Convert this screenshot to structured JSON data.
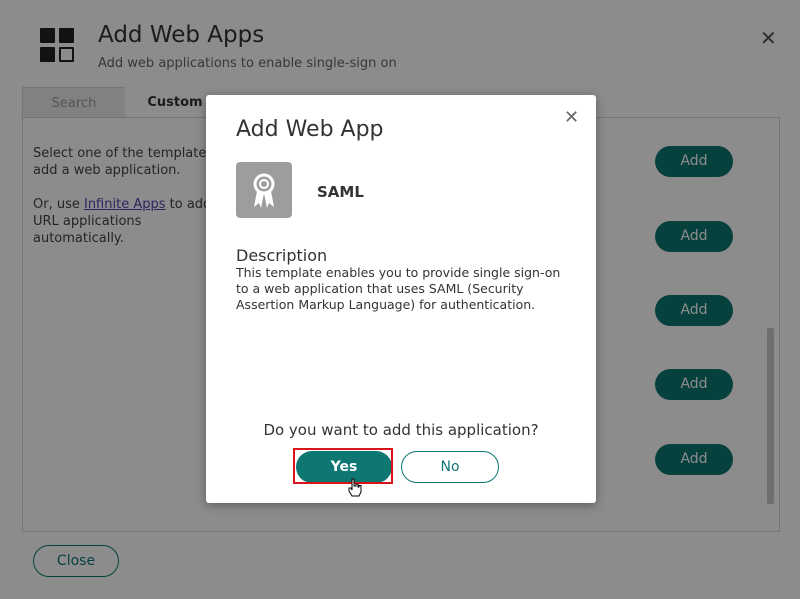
{
  "background": {
    "title": "Add Web Apps",
    "subtitle": "Add web applications to enable single-sign on",
    "tabs": [
      "Search",
      "Custom"
    ],
    "panel_text_1": "Select one of the templates to add a web application.",
    "panel_text_2_prefix": "Or, use ",
    "panel_text_2_link": "Infinite Apps",
    "panel_text_2_suffix": " to add URL applications automatically.",
    "add_label": "Add",
    "close_label": "Close"
  },
  "modal": {
    "title": "Add Web App",
    "app_name": "SAML",
    "app_icon": "certificate-ribbon-icon",
    "description_heading": "Description",
    "description_text": "This template enables you to provide single sign-on to a web application that uses SAML (Security Assertion Markup Language) for authentication.",
    "question": "Do you want to add this application?",
    "yes_label": "Yes",
    "no_label": "No"
  },
  "colors": {
    "accent": "#0e7772",
    "highlight": "#d9141b"
  }
}
